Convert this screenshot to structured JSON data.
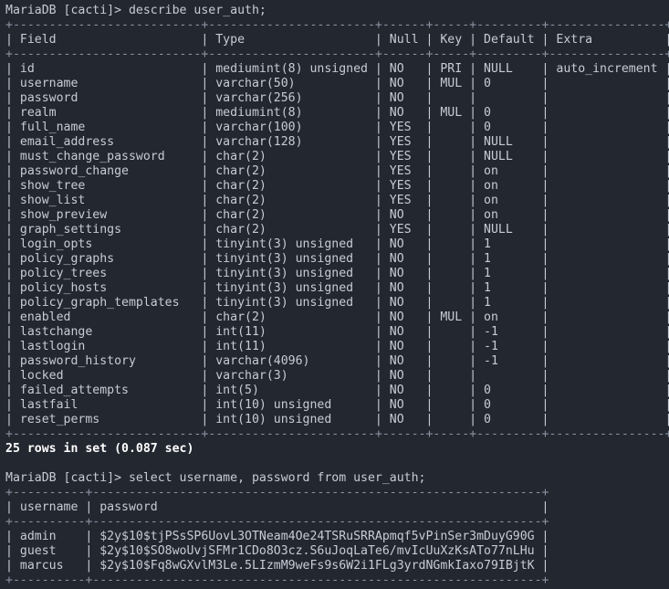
{
  "terminal": {
    "prompt": "MariaDB [cacti]> ",
    "background_color": "#232730",
    "foreground_color": "#c6ccd6",
    "rule_color": "#8b93a1",
    "highlight_color": "#ffffff"
  },
  "session": {
    "command_1": "MariaDB [cacti]> describe user_auth;",
    "command_2": "MariaDB [cacti]> select username, password from user_auth;",
    "result_1_status": "25 rows in set (0.087 sec)"
  },
  "describe_table": {
    "separator": "+--------------------------+-----------------------+------+-----+---------+----------------+",
    "header": "| Field                    | Type                  | Null | Key | Default | Extra          |",
    "columns": [
      "Field",
      "Type",
      "Null",
      "Key",
      "Default",
      "Extra"
    ],
    "rows": [
      {
        "field": "id",
        "type": "mediumint(8) unsigned",
        "null": "NO",
        "key": "PRI",
        "default": "NULL",
        "extra": "auto_increment"
      },
      {
        "field": "username",
        "type": "varchar(50)",
        "null": "NO",
        "key": "MUL",
        "default": "0",
        "extra": ""
      },
      {
        "field": "password",
        "type": "varchar(256)",
        "null": "NO",
        "key": "",
        "default": "",
        "extra": ""
      },
      {
        "field": "realm",
        "type": "mediumint(8)",
        "null": "NO",
        "key": "MUL",
        "default": "0",
        "extra": ""
      },
      {
        "field": "full_name",
        "type": "varchar(100)",
        "null": "YES",
        "key": "",
        "default": "0",
        "extra": ""
      },
      {
        "field": "email_address",
        "type": "varchar(128)",
        "null": "YES",
        "key": "",
        "default": "NULL",
        "extra": ""
      },
      {
        "field": "must_change_password",
        "type": "char(2)",
        "null": "YES",
        "key": "",
        "default": "NULL",
        "extra": ""
      },
      {
        "field": "password_change",
        "type": "char(2)",
        "null": "YES",
        "key": "",
        "default": "on",
        "extra": ""
      },
      {
        "field": "show_tree",
        "type": "char(2)",
        "null": "YES",
        "key": "",
        "default": "on",
        "extra": ""
      },
      {
        "field": "show_list",
        "type": "char(2)",
        "null": "YES",
        "key": "",
        "default": "on",
        "extra": ""
      },
      {
        "field": "show_preview",
        "type": "char(2)",
        "null": "NO",
        "key": "",
        "default": "on",
        "extra": ""
      },
      {
        "field": "graph_settings",
        "type": "char(2)",
        "null": "YES",
        "key": "",
        "default": "NULL",
        "extra": ""
      },
      {
        "field": "login_opts",
        "type": "tinyint(3) unsigned",
        "null": "NO",
        "key": "",
        "default": "1",
        "extra": ""
      },
      {
        "field": "policy_graphs",
        "type": "tinyint(3) unsigned",
        "null": "NO",
        "key": "",
        "default": "1",
        "extra": ""
      },
      {
        "field": "policy_trees",
        "type": "tinyint(3) unsigned",
        "null": "NO",
        "key": "",
        "default": "1",
        "extra": ""
      },
      {
        "field": "policy_hosts",
        "type": "tinyint(3) unsigned",
        "null": "NO",
        "key": "",
        "default": "1",
        "extra": ""
      },
      {
        "field": "policy_graph_templates",
        "type": "tinyint(3) unsigned",
        "null": "NO",
        "key": "",
        "default": "1",
        "extra": ""
      },
      {
        "field": "enabled",
        "type": "char(2)",
        "null": "NO",
        "key": "MUL",
        "default": "on",
        "extra": ""
      },
      {
        "field": "lastchange",
        "type": "int(11)",
        "null": "NO",
        "key": "",
        "default": "-1",
        "extra": ""
      },
      {
        "field": "lastlogin",
        "type": "int(11)",
        "null": "NO",
        "key": "",
        "default": "-1",
        "extra": ""
      },
      {
        "field": "password_history",
        "type": "varchar(4096)",
        "null": "NO",
        "key": "",
        "default": "-1",
        "extra": ""
      },
      {
        "field": "locked",
        "type": "varchar(3)",
        "null": "NO",
        "key": "",
        "default": "",
        "extra": ""
      },
      {
        "field": "failed_attempts",
        "type": "int(5)",
        "null": "NO",
        "key": "",
        "default": "0",
        "extra": ""
      },
      {
        "field": "lastfail",
        "type": "int(10) unsigned",
        "null": "NO",
        "key": "",
        "default": "0",
        "extra": ""
      },
      {
        "field": "reset_perms",
        "type": "int(10) unsigned",
        "null": "NO",
        "key": "",
        "default": "0",
        "extra": ""
      }
    ]
  },
  "select_table": {
    "separator": "+----------+--------------------------------------------------------------+",
    "header": "| username | password                                                     |",
    "columns": [
      "username",
      "password"
    ],
    "rows": [
      {
        "username": "admin",
        "password": "$2y$10$tjPSsSP6UovL3OTNeam4Oe24TSRuSRRApmqf5vPinSer3mDuyG90G"
      },
      {
        "username": "guest",
        "password": "$2y$10$SO8woUvjSFMr1CDo8O3cz.S6uJoqLaTe6/mvIcUuXzKsATo77nLHu"
      },
      {
        "username": "marcus",
        "password": "$2y$10$Fq8wGXvlM3Le.5LIzmM9weFs9s6W2i1FLg3yrdNGmkIaxo79IBjtK"
      }
    ]
  }
}
